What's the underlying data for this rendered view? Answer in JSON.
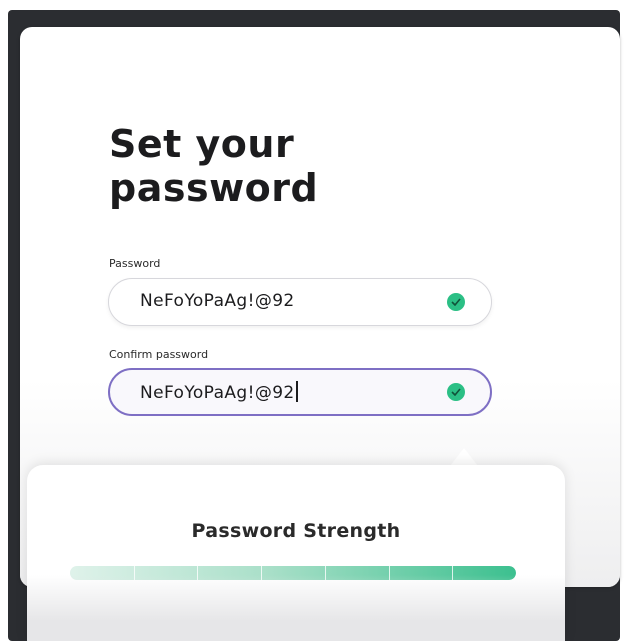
{
  "page": {
    "title_line1": "Set your",
    "title_line2": "password"
  },
  "password_field": {
    "label": "Password",
    "value": "NeFoYoPaAg!@92",
    "valid": true
  },
  "confirm_password_field": {
    "label": "Confirm password",
    "value": "NeFoYoPaAg!@92",
    "valid": true,
    "focused": true
  },
  "strength_popover": {
    "title": "Password Strength",
    "strength_fraction": 1.0,
    "segments": 7
  },
  "colors": {
    "valid_check": "#2bbf85",
    "focus_border": "#7e6fc4",
    "strength_full": "#3cc08f"
  }
}
